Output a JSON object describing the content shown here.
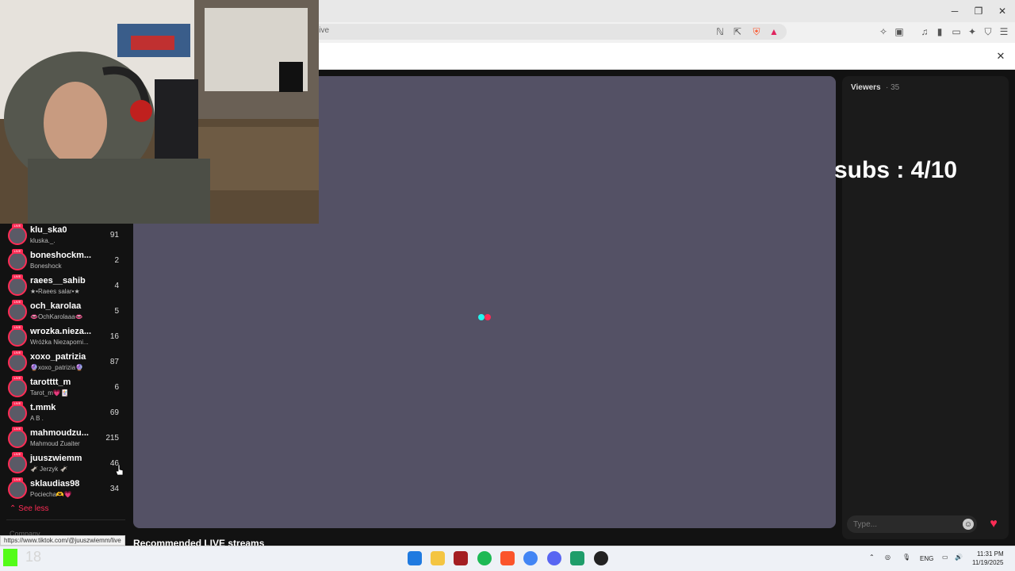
{
  "browser": {
    "url": "live",
    "window_controls": {
      "minimize": "─",
      "restore": "❐",
      "close": "✕"
    }
  },
  "banner": {
    "close_icon": "✕"
  },
  "chat": {
    "viewers_label": "Viewers",
    "viewers_count": "· 35",
    "input_placeholder": "Type...",
    "overlay_text": "subs : 4/10"
  },
  "sidebar": {
    "streamers": [
      {
        "username": "klu_ska0",
        "nickname": "kluska._.",
        "viewers": "91"
      },
      {
        "username": "boneshockm...",
        "nickname": "Boneshock",
        "viewers": "2"
      },
      {
        "username": "raees__sahib",
        "nickname": "★•Raees salar•★",
        "viewers": "4"
      },
      {
        "username": "och_karolaa",
        "nickname": "👄OchKarolaaa👄",
        "viewers": "5"
      },
      {
        "username": "wrozka.nieza...",
        "nickname": "Wróżka Niezapomi...",
        "viewers": "16"
      },
      {
        "username": "xoxo_patrizia",
        "nickname": "🔮xoxo_patrizia🔮",
        "viewers": "87"
      },
      {
        "username": "tarotttt_m",
        "nickname": "Tarot_m💗🃏",
        "viewers": "6"
      },
      {
        "username": "t.mmk",
        "nickname": "A B .",
        "viewers": "69"
      },
      {
        "username": "mahmoudzu...",
        "nickname": "Mahmoud Zuaiter",
        "viewers": "215"
      },
      {
        "username": "juuszwiemm",
        "nickname": "🫏 Jerzyk 🫏",
        "viewers": "46"
      },
      {
        "username": "sklaudias98",
        "nickname": "Pociecha🫶💗",
        "viewers": "34"
      }
    ],
    "see_less": "See less",
    "company": "Company"
  },
  "status_url": "https://www.tiktok.com/@juuszwiemm/live",
  "recommended_title": "Recommended LIVE streams",
  "taskbar": {
    "kick_number": "18",
    "language": "ENG",
    "time": "11:31 PM",
    "date": "11/19/2025"
  },
  "colors": {
    "accent": "#fe2c55",
    "player_bg": "#545165",
    "cyan": "#25f4ee"
  },
  "icons": [
    "extensions-icon",
    "brave-shield-icon",
    "share-icon",
    "menu-icon"
  ]
}
